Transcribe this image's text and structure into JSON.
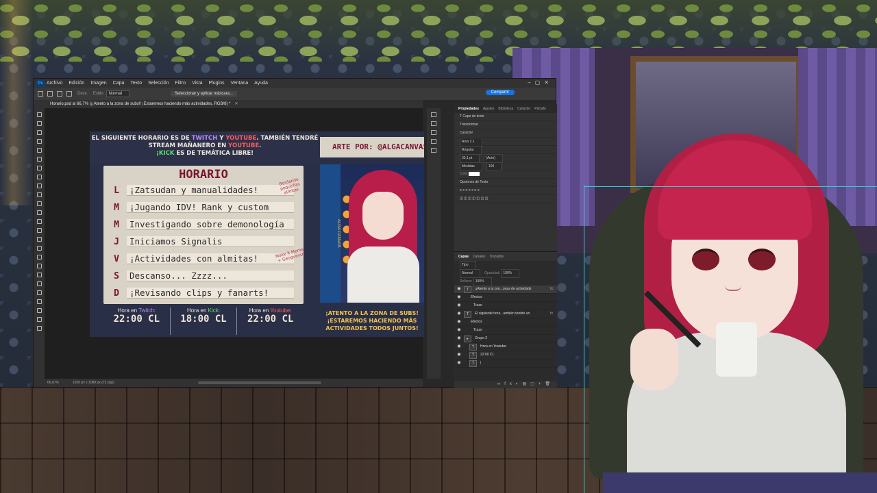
{
  "photoshop": {
    "menu": [
      "Archivo",
      "Edición",
      "Imagen",
      "Capa",
      "Texto",
      "Selección",
      "Filtro",
      "Vista",
      "Plugins",
      "Ventana",
      "Ayuda"
    ],
    "logo": "Ps",
    "options": {
      "size_label": "Desv.",
      "mode_label": "Estilo",
      "mode_value": "Normal",
      "mask_button": "Seleccionar y aplicar máscara..."
    },
    "share_button": "Compartir",
    "tab_title": "Horario.psd al 66,7% (¡¡Atento a la zona de subs!! ¡Estaremos haciendo más actividades, RGB/8) *",
    "status": {
      "zoom": "66,67%",
      "dims": "1920 px x 1080 px (72 ppp)"
    },
    "properties": {
      "tabs": [
        "Propiedades",
        "Ajustes",
        "Biblioteca",
        "Carácter",
        "Párrafo"
      ],
      "layer_type": "Capa de texto",
      "transform": "Transformar",
      "character": "Carácter",
      "font": "Arvo 2.1",
      "style": "Regular",
      "size": "33,1 pt",
      "leading": "(Auto)",
      "tracking": "Medidas",
      "scale": "100",
      "color_label": "Color",
      "paragraph": "Opciones de Texto"
    },
    "layers": {
      "tabs": [
        "Capas",
        "Canales",
        "Trazados"
      ],
      "kind": "Tipo",
      "blend": "Normal",
      "opacity_label": "Opacidad:",
      "opacity": "100%",
      "fill_label": "Relleno:",
      "fill": "100%",
      "rows": [
        {
          "name": "¡¡Atento a la zon...onas de actividade",
          "type": "T",
          "fx": "fx",
          "selected": true
        },
        {
          "name": "Efectos",
          "type": "",
          "fx": "",
          "indent": true
        },
        {
          "name": "Trazo",
          "type": "",
          "fx": "",
          "indent": true
        },
        {
          "name": "El siguiente hora...ambién tendré un",
          "type": "T",
          "fx": "fx"
        },
        {
          "name": "Efectos",
          "type": "",
          "fx": "",
          "indent": true
        },
        {
          "name": "Trazo",
          "type": "",
          "fx": "",
          "indent": true
        },
        {
          "name": "Grupo 2",
          "type": "▸",
          "fx": ""
        },
        {
          "name": "Hora en Youtube:",
          "type": "T",
          "fx": "",
          "indent": true
        },
        {
          "name": "22:00 CL",
          "type": "T",
          "fx": "",
          "indent": true
        },
        {
          "name": "|",
          "type": "T",
          "fx": "",
          "indent": true
        }
      ]
    }
  },
  "artwork": {
    "announce_1": "EL SIGUIENTE HORARIO ES DE ",
    "announce_twitch": "TWITCH",
    "announce_y": " Y ",
    "announce_youtube": "YOUTUBE",
    "announce_2": ". TAMBIÉN TENDRÉ STREAM MAÑANERO EN ",
    "announce_youtube2": "YOUTUBE",
    "announce_3": ".",
    "announce_kick": "¡KICK",
    "announce_4": " ES DE TEMÁTICA LIBRE!",
    "title": "HORARIO",
    "days": [
      {
        "day": "L",
        "activity": "¡Zatsudan y manualidades!"
      },
      {
        "day": "M",
        "activity": "¡Jugando IDV! Rank y custom"
      },
      {
        "day": "M",
        "activity": "Investigando sobre demonología"
      },
      {
        "day": "J",
        "activity": "Iniciamos Signalis"
      },
      {
        "day": "V",
        "activity": "¡Actividades con almitas!"
      },
      {
        "day": "S",
        "activity": "Descanso... Zzzz..."
      },
      {
        "day": "D",
        "activity": "¡Revisando clips y fanarts!"
      }
    ],
    "note_1": "Bordando pequeñas almitas",
    "note_2": "Make it Meme + Geoguessr",
    "footer": [
      {
        "label_pre": "Hora en ",
        "platform": "Twitch",
        "label_post": ":",
        "time": "22:00 CL",
        "color": "tw"
      },
      {
        "label_pre": "Hora en ",
        "platform": "Kick",
        "label_post": ":",
        "time": "18:00 CL",
        "color": "kk"
      },
      {
        "label_pre": "Hora en ",
        "platform": "Youtube",
        "label_post": ":",
        "time": "22:00 CL",
        "color": "yt"
      }
    ],
    "credit": "ARTE POR: @ALGACANVAS",
    "portrait_side": "ALGA CANVAS",
    "bottom_right_1": "¡ATENTO A LA ZONA DE SUBS!",
    "bottom_right_2": "¡ESTAREMOS HACIENDO MÁS",
    "bottom_right_3": "ACTIVIDADES TODOS JUNTOS!"
  },
  "colors": {
    "accent": "#1473e6",
    "twitch": "#b98cff",
    "youtube": "#ff5a5a",
    "kick": "#59e06a",
    "schedule_title": "#7a1530"
  }
}
